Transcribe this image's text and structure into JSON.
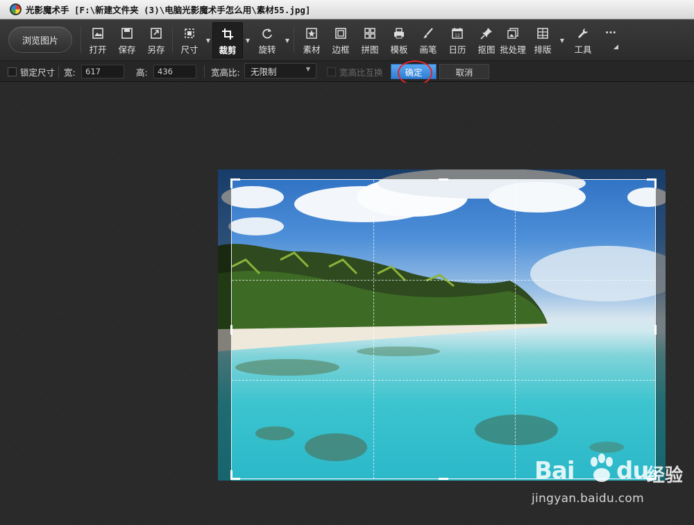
{
  "window": {
    "title": "光影魔术手 [F:\\新建文件夹 (3)\\电脑光影魔术手怎么用\\素材55.jpg]"
  },
  "toolbar": {
    "browse_label": "浏览图片",
    "tools": {
      "open": "打开",
      "save": "保存",
      "save_as": "另存",
      "size": "尺寸",
      "crop": "裁剪",
      "rotate": "旋转",
      "material": "素材",
      "border": "边框",
      "collage": "拼图",
      "template": "模板",
      "brush": "画笔",
      "calendar": "日历",
      "cutout": "抠图",
      "batch": "批处理",
      "layout": "排版",
      "tools": "工具"
    },
    "more_label": "..."
  },
  "cropbar": {
    "lock_size_label": "锁定尺寸",
    "width_label": "宽:",
    "width_value": "617",
    "height_label": "高:",
    "height_value": "436",
    "ratio_label": "宽高比:",
    "ratio_value": "无限制",
    "swap_ratio_label": "宽高比互换",
    "ok_label": "确定",
    "cancel_label": "取消"
  },
  "watermark": {
    "brand_latin": "Bai",
    "brand_latin_2": "du",
    "brand_cn": "经验",
    "url": "jingyan.baidu.com"
  },
  "colors": {
    "accent_button": "#3a8be0",
    "highlight_ring": "#e0262b"
  }
}
